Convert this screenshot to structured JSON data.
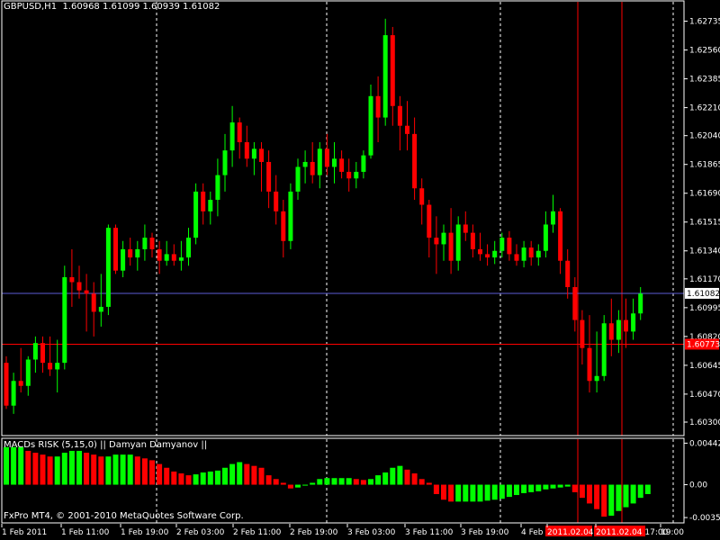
{
  "header": {
    "symbol": "GBPUSD,H1",
    "ohlc": "1.60968 1.61099 1.60939 1.61082"
  },
  "macd_panel": {
    "title": "MACDs RISK (5,15,0) || Damyan Damyanov ||"
  },
  "footer": {
    "copyright": "FxPro MT4, © 2001-2010 MetaQuotes Software Corp."
  },
  "colors": {
    "background": "#000000",
    "bull": "#00ff00",
    "bear": "#ff0000",
    "grid": "#ffffff",
    "bid_line": "#5c5cd6",
    "red_line": "#ff0000",
    "axis": "#ffffff"
  },
  "chart_data": [
    {
      "type": "candlestick",
      "ylim": [
        1.603,
        1.6282
      ],
      "price_axis_ticks": [
        "1.62735",
        "1.62560",
        "1.62385",
        "1.62210",
        "1.62040",
        "1.61865",
        "1.61690",
        "1.61515",
        "1.61340",
        "1.61170",
        "1.60995",
        "1.60820",
        "1.60645",
        "1.60470",
        "1.60300"
      ],
      "current_price_label": "1.61082",
      "current_price": 1.61082,
      "horizontal_line_label": "1.60773",
      "horizontal_line_price": 1.60773,
      "time_labels": [
        "1 Feb 2011",
        "1 Feb 11:00",
        "1 Feb 19:00",
        "2 Feb 03:00",
        "2 Feb 11:00",
        "2 Feb 19:00",
        "3 Feb 03:00",
        "3 Feb 11:00",
        "3 Feb 19:00",
        "4 Feb",
        "2011.02.04 11:00",
        "2011.02.04 17:00",
        "19:00"
      ],
      "grid": true,
      "candles": [
        {
          "o": 1.6066,
          "h": 1.607,
          "l": 1.6038,
          "c": 1.604
        },
        {
          "o": 1.604,
          "h": 1.606,
          "l": 1.6035,
          "c": 1.6055
        },
        {
          "o": 1.6055,
          "h": 1.6075,
          "l": 1.6048,
          "c": 1.6052
        },
        {
          "o": 1.6052,
          "h": 1.607,
          "l": 1.6046,
          "c": 1.6068
        },
        {
          "o": 1.6068,
          "h": 1.6082,
          "l": 1.606,
          "c": 1.6078
        },
        {
          "o": 1.6078,
          "h": 1.6082,
          "l": 1.606,
          "c": 1.6066
        },
        {
          "o": 1.6066,
          "h": 1.6082,
          "l": 1.6058,
          "c": 1.6062
        },
        {
          "o": 1.6062,
          "h": 1.608,
          "l": 1.6048,
          "c": 1.6066
        },
        {
          "o": 1.6066,
          "h": 1.6125,
          "l": 1.6062,
          "c": 1.6118
        },
        {
          "o": 1.6118,
          "h": 1.6135,
          "l": 1.61,
          "c": 1.6115
        },
        {
          "o": 1.6115,
          "h": 1.6125,
          "l": 1.6105,
          "c": 1.611
        },
        {
          "o": 1.611,
          "h": 1.612,
          "l": 1.6085,
          "c": 1.6108
        },
        {
          "o": 1.6108,
          "h": 1.6115,
          "l": 1.6082,
          "c": 1.6097
        },
        {
          "o": 1.6097,
          "h": 1.612,
          "l": 1.6088,
          "c": 1.61
        },
        {
          "o": 1.61,
          "h": 1.615,
          "l": 1.6095,
          "c": 1.6148
        },
        {
          "o": 1.6148,
          "h": 1.615,
          "l": 1.612,
          "c": 1.6122
        },
        {
          "o": 1.6122,
          "h": 1.614,
          "l": 1.6118,
          "c": 1.6135
        },
        {
          "o": 1.6135,
          "h": 1.6142,
          "l": 1.6125,
          "c": 1.613
        },
        {
          "o": 1.613,
          "h": 1.614,
          "l": 1.6122,
          "c": 1.6135
        },
        {
          "o": 1.6135,
          "h": 1.615,
          "l": 1.6128,
          "c": 1.6142
        },
        {
          "o": 1.6142,
          "h": 1.6145,
          "l": 1.613,
          "c": 1.6135
        },
        {
          "o": 1.6135,
          "h": 1.614,
          "l": 1.612,
          "c": 1.6128
        },
        {
          "o": 1.6128,
          "h": 1.614,
          "l": 1.6125,
          "c": 1.6132
        },
        {
          "o": 1.6132,
          "h": 1.6138,
          "l": 1.6125,
          "c": 1.6128
        },
        {
          "o": 1.6128,
          "h": 1.614,
          "l": 1.6122,
          "c": 1.613
        },
        {
          "o": 1.613,
          "h": 1.6148,
          "l": 1.6125,
          "c": 1.6142
        },
        {
          "o": 1.6142,
          "h": 1.6175,
          "l": 1.6138,
          "c": 1.617
        },
        {
          "o": 1.617,
          "h": 1.6175,
          "l": 1.615,
          "c": 1.6158
        },
        {
          "o": 1.6158,
          "h": 1.617,
          "l": 1.615,
          "c": 1.6165
        },
        {
          "o": 1.6165,
          "h": 1.619,
          "l": 1.6155,
          "c": 1.618
        },
        {
          "o": 1.618,
          "h": 1.6205,
          "l": 1.617,
          "c": 1.6195
        },
        {
          "o": 1.6195,
          "h": 1.6222,
          "l": 1.6185,
          "c": 1.6212
        },
        {
          "o": 1.6212,
          "h": 1.6215,
          "l": 1.619,
          "c": 1.62
        },
        {
          "o": 1.62,
          "h": 1.621,
          "l": 1.6185,
          "c": 1.619
        },
        {
          "o": 1.619,
          "h": 1.62,
          "l": 1.618,
          "c": 1.6196
        },
        {
          "o": 1.6196,
          "h": 1.62,
          "l": 1.617,
          "c": 1.6188
        },
        {
          "o": 1.6188,
          "h": 1.6195,
          "l": 1.616,
          "c": 1.617
        },
        {
          "o": 1.617,
          "h": 1.618,
          "l": 1.615,
          "c": 1.6158
        },
        {
          "o": 1.6158,
          "h": 1.6165,
          "l": 1.613,
          "c": 1.614
        },
        {
          "o": 1.614,
          "h": 1.6175,
          "l": 1.6135,
          "c": 1.617
        },
        {
          "o": 1.617,
          "h": 1.619,
          "l": 1.6165,
          "c": 1.6185
        },
        {
          "o": 1.6185,
          "h": 1.6195,
          "l": 1.6175,
          "c": 1.6188
        },
        {
          "o": 1.6188,
          "h": 1.62,
          "l": 1.6175,
          "c": 1.618
        },
        {
          "o": 1.618,
          "h": 1.62,
          "l": 1.6172,
          "c": 1.6196
        },
        {
          "o": 1.6196,
          "h": 1.6205,
          "l": 1.618,
          "c": 1.6185
        },
        {
          "o": 1.6185,
          "h": 1.62,
          "l": 1.6175,
          "c": 1.619
        },
        {
          "o": 1.619,
          "h": 1.6195,
          "l": 1.6178,
          "c": 1.6182
        },
        {
          "o": 1.6182,
          "h": 1.619,
          "l": 1.617,
          "c": 1.6178
        },
        {
          "o": 1.6178,
          "h": 1.6188,
          "l": 1.6172,
          "c": 1.6182
        },
        {
          "o": 1.6182,
          "h": 1.6195,
          "l": 1.6178,
          "c": 1.6192
        },
        {
          "o": 1.6192,
          "h": 1.6235,
          "l": 1.619,
          "c": 1.6228
        },
        {
          "o": 1.6228,
          "h": 1.624,
          "l": 1.62,
          "c": 1.6215
        },
        {
          "o": 1.6215,
          "h": 1.6275,
          "l": 1.621,
          "c": 1.6265
        },
        {
          "o": 1.6265,
          "h": 1.627,
          "l": 1.621,
          "c": 1.6222
        },
        {
          "o": 1.6222,
          "h": 1.6228,
          "l": 1.6195,
          "c": 1.621
        },
        {
          "o": 1.621,
          "h": 1.6225,
          "l": 1.6195,
          "c": 1.6205
        },
        {
          "o": 1.6205,
          "h": 1.6215,
          "l": 1.6165,
          "c": 1.6172
        },
        {
          "o": 1.6172,
          "h": 1.6178,
          "l": 1.615,
          "c": 1.6162
        },
        {
          "o": 1.6162,
          "h": 1.6165,
          "l": 1.613,
          "c": 1.6142
        },
        {
          "o": 1.6142,
          "h": 1.6155,
          "l": 1.612,
          "c": 1.6138
        },
        {
          "o": 1.6138,
          "h": 1.615,
          "l": 1.6128,
          "c": 1.6145
        },
        {
          "o": 1.6145,
          "h": 1.616,
          "l": 1.612,
          "c": 1.6128
        },
        {
          "o": 1.6128,
          "h": 1.6155,
          "l": 1.6122,
          "c": 1.615
        },
        {
          "o": 1.615,
          "h": 1.6158,
          "l": 1.614,
          "c": 1.6145
        },
        {
          "o": 1.6145,
          "h": 1.615,
          "l": 1.613,
          "c": 1.6135
        },
        {
          "o": 1.6135,
          "h": 1.6145,
          "l": 1.6128,
          "c": 1.6132
        },
        {
          "o": 1.6132,
          "h": 1.6138,
          "l": 1.6125,
          "c": 1.613
        },
        {
          "o": 1.613,
          "h": 1.614,
          "l": 1.6126,
          "c": 1.6134
        },
        {
          "o": 1.6134,
          "h": 1.6145,
          "l": 1.613,
          "c": 1.6142
        },
        {
          "o": 1.6142,
          "h": 1.6146,
          "l": 1.6128,
          "c": 1.6132
        },
        {
          "o": 1.6132,
          "h": 1.6138,
          "l": 1.6125,
          "c": 1.6128
        },
        {
          "o": 1.6128,
          "h": 1.614,
          "l": 1.6124,
          "c": 1.6136
        },
        {
          "o": 1.6136,
          "h": 1.614,
          "l": 1.6125,
          "c": 1.613
        },
        {
          "o": 1.613,
          "h": 1.6138,
          "l": 1.6125,
          "c": 1.6134
        },
        {
          "o": 1.6134,
          "h": 1.6158,
          "l": 1.613,
          "c": 1.615
        },
        {
          "o": 1.615,
          "h": 1.6168,
          "l": 1.6145,
          "c": 1.6158
        },
        {
          "o": 1.6158,
          "h": 1.616,
          "l": 1.612,
          "c": 1.6128
        },
        {
          "o": 1.6128,
          "h": 1.6135,
          "l": 1.6105,
          "c": 1.6112
        },
        {
          "o": 1.6112,
          "h": 1.6118,
          "l": 1.6085,
          "c": 1.6092
        },
        {
          "o": 1.6092,
          "h": 1.6098,
          "l": 1.6065,
          "c": 1.6075
        },
        {
          "o": 1.6075,
          "h": 1.6095,
          "l": 1.6048,
          "c": 1.6055
        },
        {
          "o": 1.6055,
          "h": 1.6085,
          "l": 1.6048,
          "c": 1.6058
        },
        {
          "o": 1.6058,
          "h": 1.6095,
          "l": 1.6055,
          "c": 1.609
        },
        {
          "o": 1.609,
          "h": 1.6105,
          "l": 1.607,
          "c": 1.608
        },
        {
          "o": 1.608,
          "h": 1.6098,
          "l": 1.6072,
          "c": 1.6092
        },
        {
          "o": 1.6092,
          "h": 1.6105,
          "l": 1.6075,
          "c": 1.6085
        },
        {
          "o": 1.6085,
          "h": 1.6105,
          "l": 1.608,
          "c": 1.6096
        },
        {
          "o": 1.6096,
          "h": 1.6112,
          "l": 1.6092,
          "c": 1.6108
        }
      ]
    },
    {
      "type": "bar",
      "title": "MACDs RISK (5,15,0) || Damyan Damyanov ||",
      "ylim": [
        -0.00378,
        0.00465
      ],
      "axis_ticks": [
        "0.00442",
        "0.00",
        "-0.00350"
      ],
      "values": [
        0.004,
        0.004,
        0.004,
        0.0036,
        0.0034,
        0.0032,
        0.003,
        0.003,
        0.0034,
        0.0036,
        0.0036,
        0.0034,
        0.0032,
        0.003,
        0.003,
        0.0032,
        0.0032,
        0.0032,
        0.003,
        0.0028,
        0.0026,
        0.0022,
        0.0018,
        0.0014,
        0.0012,
        0.001,
        0.0011,
        0.0013,
        0.0014,
        0.0015,
        0.0018,
        0.0022,
        0.0024,
        0.0022,
        0.002,
        0.0018,
        0.001,
        0.0006,
        0.0002,
        -0.0004,
        -0.0003,
        -0.0001,
        0.0002,
        0.0006,
        0.0007,
        0.0007,
        0.0007,
        0.0007,
        0.0006,
        0.0005,
        0.0006,
        0.001,
        0.0013,
        0.0018,
        0.002,
        0.0016,
        0.0012,
        0.0006,
        0.0002,
        -0.001,
        -0.0016,
        -0.0018,
        -0.0018,
        -0.0018,
        -0.0018,
        -0.0018,
        -0.0017,
        -0.0016,
        -0.0015,
        -0.0013,
        -0.0011,
        -0.0009,
        -0.0008,
        -0.0007,
        -0.0005,
        -0.0004,
        -0.0003,
        -0.0002,
        -0.0008,
        -0.0014,
        -0.002,
        -0.0026,
        -0.0034,
        -0.0033,
        -0.0028,
        -0.0024,
        -0.002,
        -0.0014,
        -0.001
      ]
    }
  ]
}
